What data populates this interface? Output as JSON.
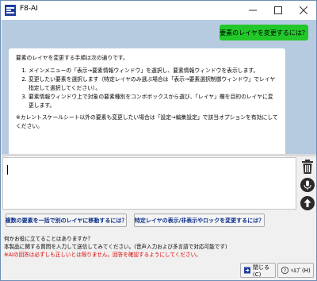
{
  "window": {
    "title": "F8-AI",
    "minimize": "—",
    "maximize": "☐",
    "close": "✕"
  },
  "chat": {
    "user_message": "要素のレイヤを変更するには？",
    "ai_intro": "要素のレイヤを変更する手順は次の通りです。",
    "ai_steps": [
      "メインメニューの「表示→要素情報ウィンドウ」を選択し、要素情報ウィンドウを表示します。",
      "変更したい要素を選択します（特定レイヤのみ選ぶ場合は「表示→要素選択制御ウィンドウ」でレイヤ指定して選択してください）。",
      "要素情報ウィンドウ上で対象の要素種別をコンボボックスから選び、「レイヤ」欄を目的のレイヤに変更します。"
    ],
    "ai_note": "※カレントスケールシート以外の要素も変更したい場合は「設定→編集設定」で該当オプションを有効にしてください。"
  },
  "input": {
    "value": ""
  },
  "tools": {
    "trash_icon": "trash-icon",
    "mic_icon": "mic-icon",
    "send_icon": "send-up-icon"
  },
  "suggestions": [
    "複数の要素を一括で別のレイヤに移動するには？",
    "特定レイヤの表示/非表示やロックを変更するには？"
  ],
  "info": {
    "line1": "何かお役に立てることはありますか？",
    "line2": "本製品に関する質問を入力して送信してみてください。(音声入力および多言語で対応可能です)",
    "warning": "※AIの回答は必ずしも正しいとは限りません。回答を確認するようにしてください。"
  },
  "footer": {
    "close_label": "閉じる(C)",
    "help_label": "ﾍﾙﾌﾟ(H)"
  },
  "colors": {
    "chat_bg": "#b6cbe0",
    "user_bubble": "#22c82a",
    "suggestion_text": "#0b2f8a",
    "warning_text": "#e00000"
  }
}
